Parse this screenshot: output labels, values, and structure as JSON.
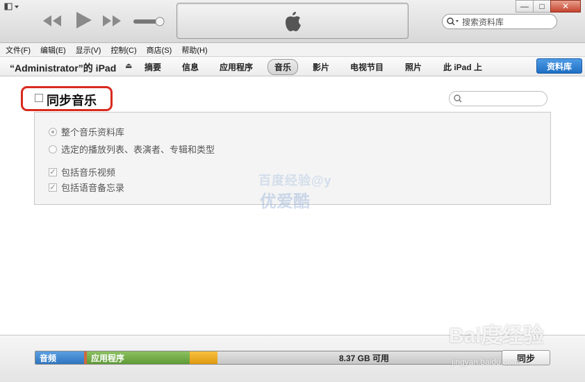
{
  "menu": {
    "items": [
      "文件(F)",
      "编辑(E)",
      "显示(V)",
      "控制(C)",
      "商店(S)",
      "帮助(H)"
    ]
  },
  "search_top": {
    "placeholder": "搜索资料库"
  },
  "device": {
    "name": "“Administrator”的 iPad",
    "eject_icon": "eject-icon"
  },
  "tabs": [
    {
      "label": "摘要"
    },
    {
      "label": "信息"
    },
    {
      "label": "应用程序"
    },
    {
      "label": "音乐",
      "active": true
    },
    {
      "label": "影片"
    },
    {
      "label": "电视节目"
    },
    {
      "label": "照片"
    },
    {
      "label": "此 iPad 上"
    }
  ],
  "library_button": "资料库",
  "sync_music": {
    "title": "同步音乐",
    "checked": false
  },
  "options": {
    "entire_library": "整个音乐资料库",
    "selected": "选定的播放列表、表演者、专辑和类型",
    "include_videos": "包括音乐视频",
    "include_voice_memos": "包括语音备忘录"
  },
  "capacity": {
    "audio_label": "音频",
    "apps_label": "应用程序",
    "free_label": "8.37 GB 可用"
  },
  "sync_button": "同步",
  "watermarks": {
    "line1": "百度经验@y",
    "line2": "优爱酷",
    "baidu": "Bai度经验",
    "url": "jingyan.baidu.com"
  },
  "colors": {
    "accent": "#1f6fc4",
    "highlight_red": "#d9291e",
    "audio": "#2f75c0",
    "apps": "#5f9b36",
    "other": "#e09a10"
  }
}
